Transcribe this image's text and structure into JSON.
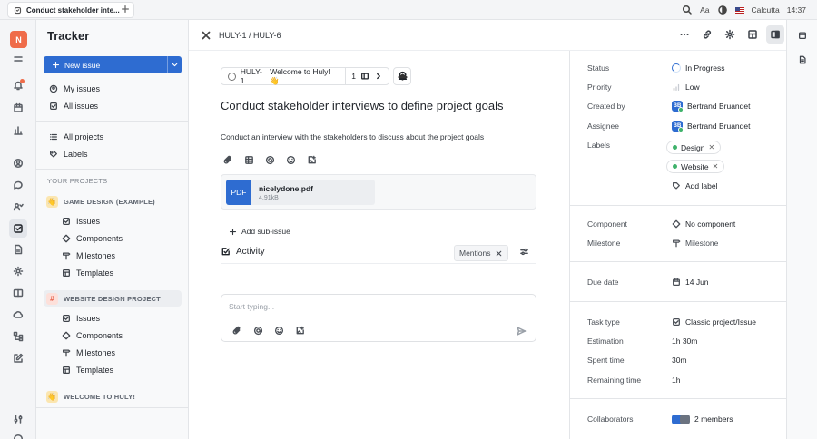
{
  "topbar": {
    "tab_title": "Conduct stakeholder inte...",
    "font_label": "Aa",
    "location": "Calcutta",
    "time": "14:37"
  },
  "workspace": {
    "initial": "N",
    "brand_color": "#ef6c4a"
  },
  "navigator": {
    "title": "Tracker",
    "new_issue_label": "New issue",
    "my_issues": "My issues",
    "all_issues": "All issues",
    "all_projects": "All projects",
    "labels": "Labels",
    "your_projects": "YOUR PROJECTS",
    "projects": [
      {
        "name": "GAME DESIGN (EXAMPLE)",
        "items": [
          "Issues",
          "Components",
          "Milestones",
          "Templates"
        ]
      },
      {
        "name": "WEBSITE DESIGN PROJECT",
        "items": [
          "Issues",
          "Components",
          "Milestones",
          "Templates"
        ]
      },
      {
        "name": "WELCOME TO HULY!",
        "items": []
      }
    ]
  },
  "header": {
    "breadcrumb": "HULY-1 / HULY-6"
  },
  "issue": {
    "parent_id": "HULY-1",
    "parent_title": "Welcome to Huly! 👋",
    "sub_count": "1",
    "title": "Conduct stakeholder interviews to define project goals",
    "description": "Conduct an interview with the stakeholders to discuss about the project goals",
    "attachment": {
      "type": "PDF",
      "name": "nicelydone.pdf",
      "size": "4.91kB"
    },
    "add_sub_issue": "Add sub-issue",
    "activity_title": "Activity",
    "mentions_label": "Mentions",
    "comment_placeholder": "Start typing..."
  },
  "properties": {
    "status_label": "Status",
    "status": "In Progress",
    "priority_label": "Priority",
    "priority": "Low",
    "created_by_label": "Created by",
    "created_by": "Bertrand Bruandet",
    "assignee_label": "Assignee",
    "assignee": "Bertrand Bruandet",
    "avatar_initials": "BB",
    "labels_label": "Labels",
    "labels": [
      "Design",
      "Website"
    ],
    "add_label": "Add label",
    "component_label": "Component",
    "component": "No component",
    "milestone_label": "Milestone",
    "milestone": "Milestone",
    "due_date_label": "Due date",
    "due_date": "14 Jun",
    "task_type_label": "Task type",
    "task_type": "Classic project/Issue",
    "estimation_label": "Estimation",
    "estimation": "1h 30m",
    "spent_time_label": "Spent time",
    "spent_time": "30m",
    "remaining_time_label": "Remaining time",
    "remaining_time": "1h",
    "collaborators_label": "Collaborators",
    "collaborators": "2 members"
  },
  "colors": {
    "accent": "#2e6cd1",
    "label_dot": "#3fb26b"
  }
}
